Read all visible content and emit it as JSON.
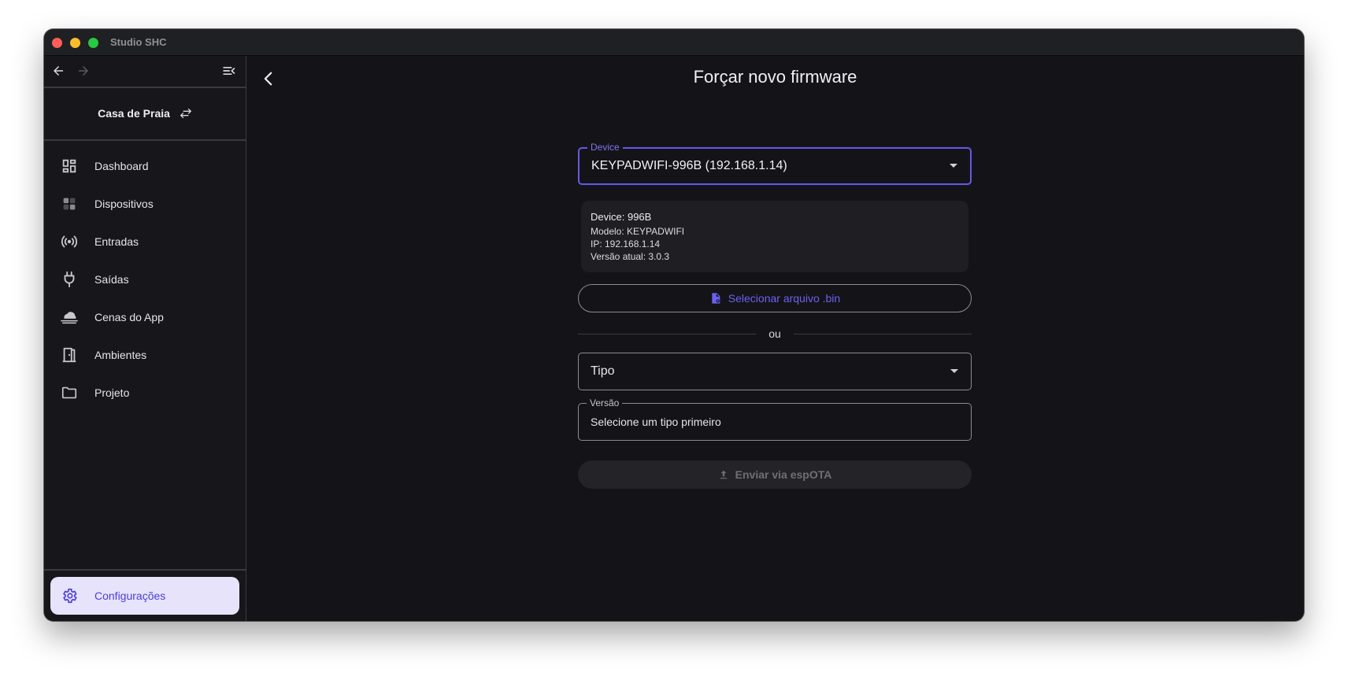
{
  "window": {
    "title": "Studio SHC"
  },
  "sidebar": {
    "project_name": "Casa de Praia",
    "items": [
      {
        "label": "Dashboard",
        "icon": "dashboard-icon"
      },
      {
        "label": "Dispositivos",
        "icon": "devices-icon"
      },
      {
        "label": "Entradas",
        "icon": "broadcast-icon"
      },
      {
        "label": "Saídas",
        "icon": "plug-icon"
      },
      {
        "label": "Cenas do App",
        "icon": "cloud-icon"
      },
      {
        "label": "Ambientes",
        "icon": "door-icon"
      },
      {
        "label": "Projeto",
        "icon": "folder-icon"
      }
    ],
    "settings_label": "Configurações"
  },
  "main": {
    "title": "Forçar novo firmware",
    "device_field": {
      "label": "Device",
      "value": "KEYPADWIFI-996B (192.168.1.14)"
    },
    "info": {
      "device": "Device: 996B",
      "model": "Modelo: KEYPADWIFI",
      "ip": "IP: 192.168.1.14",
      "version": "Versão atual: 3.0.3"
    },
    "select_file_label": "Selecionar arquivo .bin",
    "or_label": "ou",
    "tipo_field": {
      "placeholder": "Tipo"
    },
    "versao_field": {
      "label": "Versão",
      "value": "Selecione um tipo primeiro"
    },
    "send_button_label": "Enviar via espOTA"
  },
  "colors": {
    "accent": "#6359e8",
    "selected_bg": "#e6e3fb",
    "background": "#141418"
  }
}
